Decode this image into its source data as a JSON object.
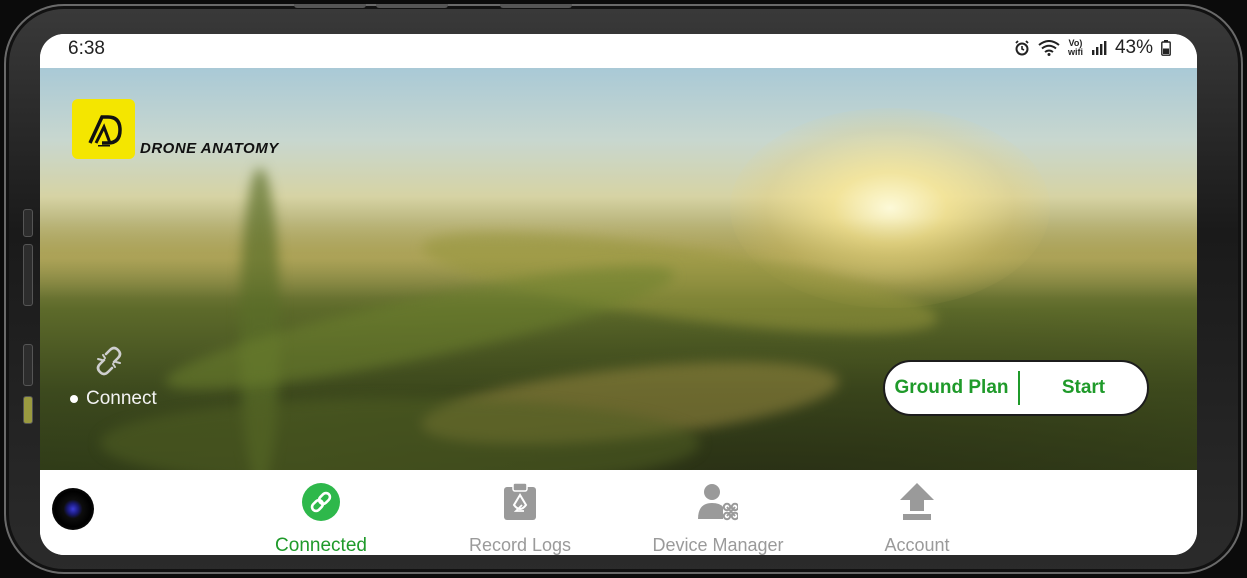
{
  "status_bar": {
    "time": "6:38",
    "volte_top": "Vo)",
    "volte_bottom": "wifi",
    "battery_percent": "43%",
    "icons": [
      "alarm-icon",
      "wifi-icon",
      "volte-wifi-icon",
      "signal-icon",
      "battery-icon"
    ]
  },
  "brand": {
    "name": "DRONE ANATOMY",
    "logo_color": "#f4e600"
  },
  "hero": {
    "connect_label": "Connect",
    "connect_icon": "broken-link-icon"
  },
  "action_pill": {
    "left_label": "Ground Plan",
    "right_label": "Start",
    "accent_color": "#1f9a2a"
  },
  "bottom_nav": {
    "items": [
      {
        "label": "Connected",
        "icon": "link-icon",
        "active": true
      },
      {
        "label": "Record Logs",
        "icon": "clipboard-icon",
        "active": false
      },
      {
        "label": "Device Manager",
        "icon": "user-drone-icon",
        "active": false
      },
      {
        "label": "Account",
        "icon": "upload-arrow-icon",
        "active": false
      }
    ]
  }
}
